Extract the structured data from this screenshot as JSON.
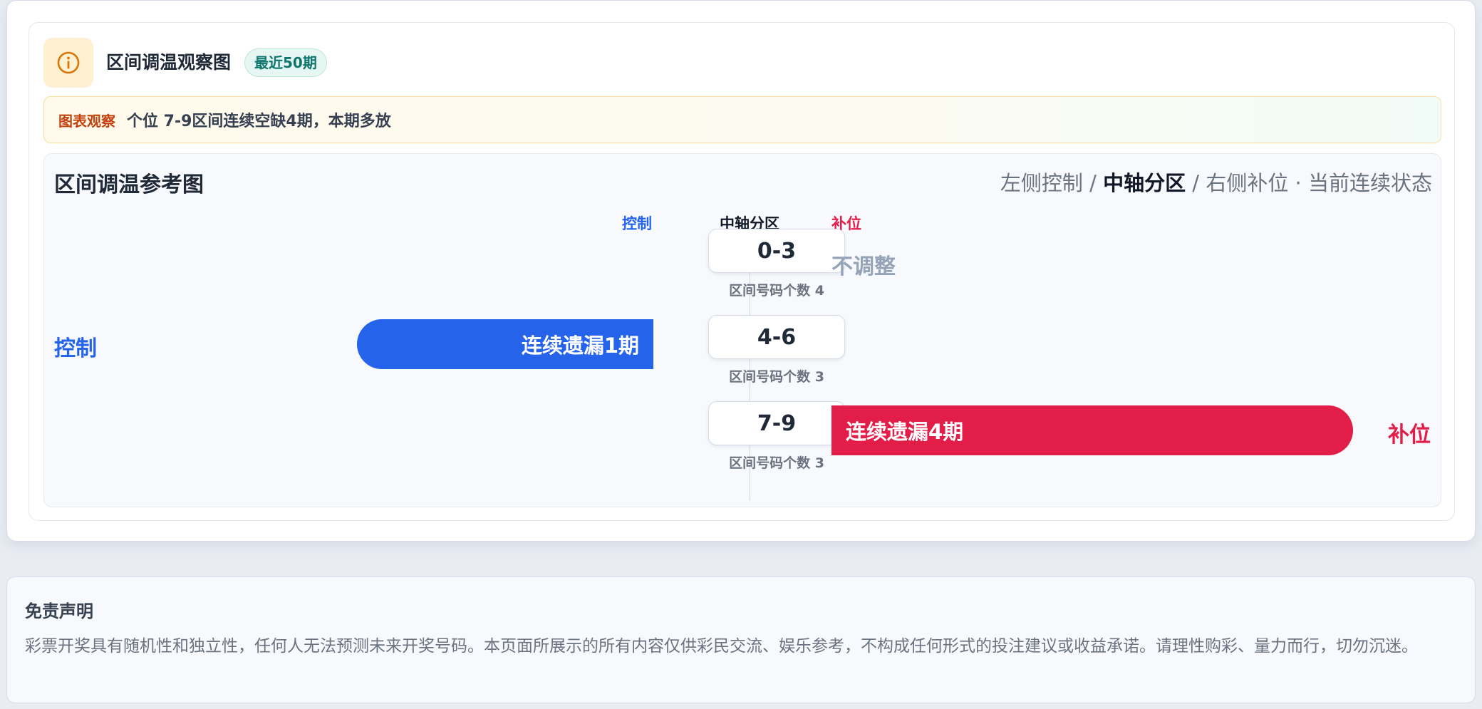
{
  "header": {
    "title": "区间调温观察图",
    "badge": "最近50期",
    "icon": "info-circle-icon"
  },
  "observation": {
    "tag": "图表观察",
    "text": "个位 7-9区间连续空缺4期，本期多放"
  },
  "chart": {
    "title": "区间调温参考图",
    "legend": {
      "left": "左侧控制",
      "sep1": " / ",
      "middle": "中轴分区",
      "sep2": " / ",
      "right": "右侧补位",
      "dot": " · ",
      "tail": "当前连续状态"
    },
    "columns": {
      "control": "控制",
      "axis": "中轴分区",
      "fill": "补位"
    }
  },
  "chart_data": {
    "type": "bar",
    "categories": [
      "0-3",
      "4-6",
      "7-9"
    ],
    "zone_counts": [
      "区间号码个数 4",
      "区间号码个数 3",
      "区间号码个数 3"
    ],
    "rows": [
      {
        "zone": "0-3",
        "count_label": "区间号码个数 4",
        "side": "none",
        "status": "不调整",
        "missed_periods": 0
      },
      {
        "zone": "4-6",
        "count_label": "区间号码个数 3",
        "side": "control",
        "side_label": "控制",
        "bar_label": "连续遗漏1期",
        "missed_periods": 1
      },
      {
        "zone": "7-9",
        "count_label": "区间号码个数 3",
        "side": "fill",
        "side_label": "补位",
        "bar_label": "连续遗漏4期",
        "missed_periods": 4
      }
    ],
    "colors": {
      "control": "#2563eb",
      "fill": "#e11d48",
      "neutral": "#94a3b8"
    }
  },
  "disclaimer": {
    "title": "免责声明",
    "text": "彩票开奖具有随机性和独立性，任何人无法预测未来开奖号码。本页面所展示的所有内容仅供彩民交流、娱乐参考，不构成任何形式的投注建议或收益承诺。请理性购彩、量力而行，切勿沉迷。"
  }
}
